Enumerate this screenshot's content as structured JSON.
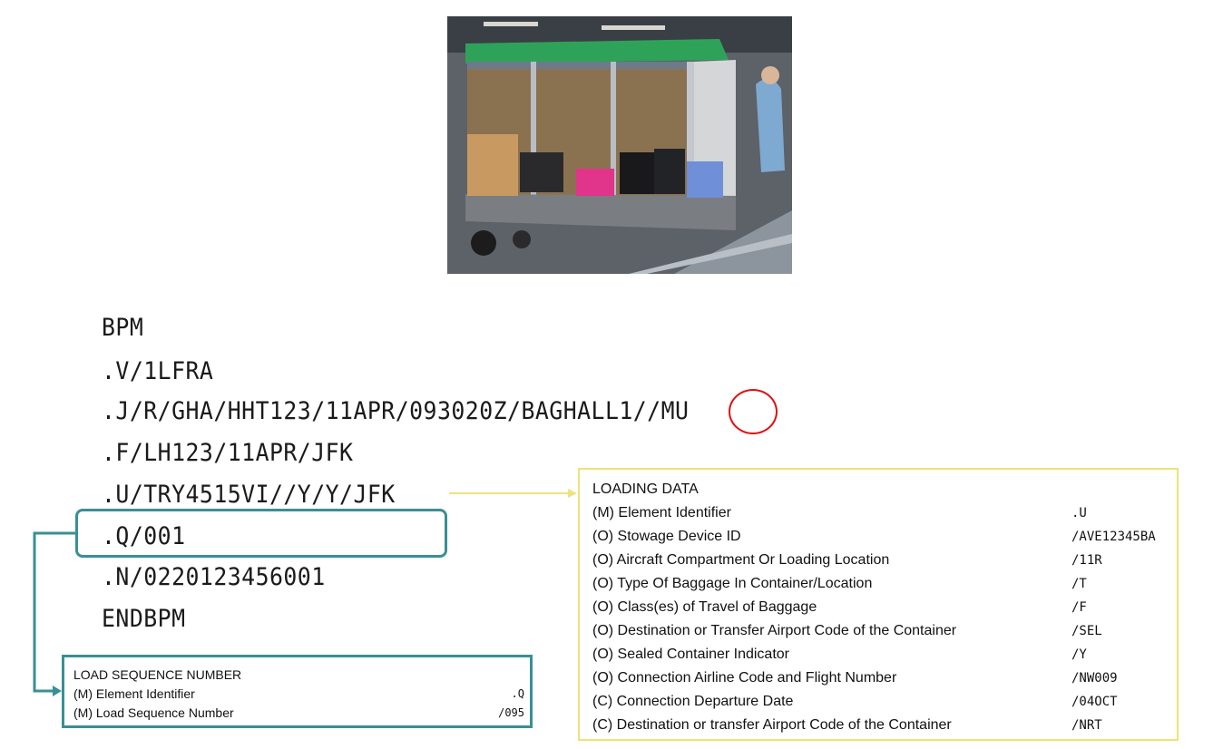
{
  "message": {
    "lines": [
      "BPM",
      ".V/1LFRA",
      ".J/R/GHA/HHT123/11APR/093020Z/BAGHALL1//MU",
      ".F/LH123/11APR/JFK",
      ".U/TRY4515VI//Y/Y/JFK",
      ".Q/001",
      ".N/0220123456001",
      "ENDBPM"
    ]
  },
  "load_sequence": {
    "title": "LOAD SEQUENCE NUMBER",
    "rows": [
      {
        "label": "(M) Element Identifier",
        "code": ".Q"
      },
      {
        "label": "(M) Load Sequence Number",
        "code": "/095"
      }
    ]
  },
  "loading_data": {
    "title": "LOADING DATA",
    "rows": [
      {
        "label": "(M) Element Identifier",
        "code": ".U"
      },
      {
        "label": "(O) Stowage Device ID",
        "code": "/AVE12345BA"
      },
      {
        "label": "(O) Aircraft Compartment Or Loading Location",
        "code": "/11R"
      },
      {
        "label": "(O) Type Of Baggage In Container/Location",
        "code": "/T"
      },
      {
        "label": "(O) Class(es) of Travel of Baggage",
        "code": "/F"
      },
      {
        "label": "(O) Destination or Transfer Airport Code of the Container",
        "code": "/SEL"
      },
      {
        "label": "(O) Sealed Container Indicator",
        "code": "/Y"
      },
      {
        "label": "(O) Connection Airline Code and Flight Number",
        "code": "/NW009"
      },
      {
        "label": "(C) Connection Departure Date",
        "code": "/04OCT"
      },
      {
        "label": "(C) Destination or transfer Airport Code of the Container",
        "code": "/NRT"
      }
    ]
  },
  "colors": {
    "teal": "#3a8f95",
    "yellow": "#efe27a",
    "red": "#e01010"
  }
}
